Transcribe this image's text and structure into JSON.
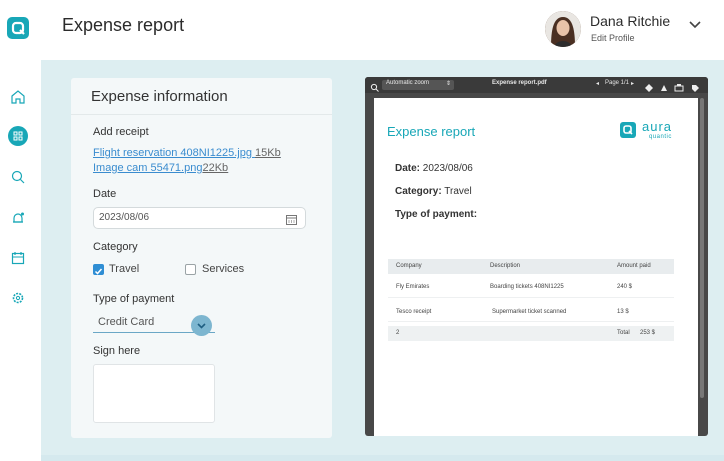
{
  "header": {
    "title": "Expense report",
    "user_name": "Dana Ritchie",
    "edit_profile": "Edit Profile"
  },
  "sidebar": {
    "items": [
      {
        "name": "home-icon"
      },
      {
        "name": "dashboard-icon",
        "active": true
      },
      {
        "name": "search-icon"
      },
      {
        "name": "notifications-icon"
      },
      {
        "name": "calendar-icon"
      },
      {
        "name": "settings-icon"
      }
    ]
  },
  "form": {
    "title": "Expense information",
    "add_receipt_label": "Add receipt",
    "receipts": [
      {
        "name": "Flight reservation 408NI1225.jpg",
        "size": "15Kb"
      },
      {
        "name": "Image cam 55471.png",
        "size": "22Kb"
      }
    ],
    "date_label": "Date",
    "date_value": "2023/08/06",
    "category_label": "Category",
    "category_options": [
      {
        "label": "Travel",
        "checked": true
      },
      {
        "label": "Services",
        "checked": false
      }
    ],
    "payment_label": "Type of payment",
    "payment_value": "Credit Card",
    "sign_label": "Sign here"
  },
  "pdf_viewer": {
    "zoom": "Automatic zoom",
    "file_name": "Expense report.pdf",
    "page": "Page 1/1",
    "document": {
      "title": "Expense report",
      "brand": "aura",
      "brand_sub": "quantic",
      "date_label": "Date:",
      "date_value": "2023/08/06",
      "category_label": "Category:",
      "category_value": "Travel",
      "payment_label": "Type of payment:",
      "table": {
        "headers": [
          "Company",
          "Description",
          "Amount paid"
        ],
        "rows": [
          [
            "Fly Emirates",
            "Boarding tickets 408NI1225",
            "240 $"
          ],
          [
            "Tesco receipt",
            "Supermarket ticket scanned",
            "13 $"
          ]
        ],
        "footer_count": "2",
        "footer_total_label": "Total",
        "footer_total_value": "253 $"
      }
    }
  },
  "colors": {
    "accent": "#18a7b7",
    "link": "#3a8ccf",
    "background": "#ddeef1"
  }
}
